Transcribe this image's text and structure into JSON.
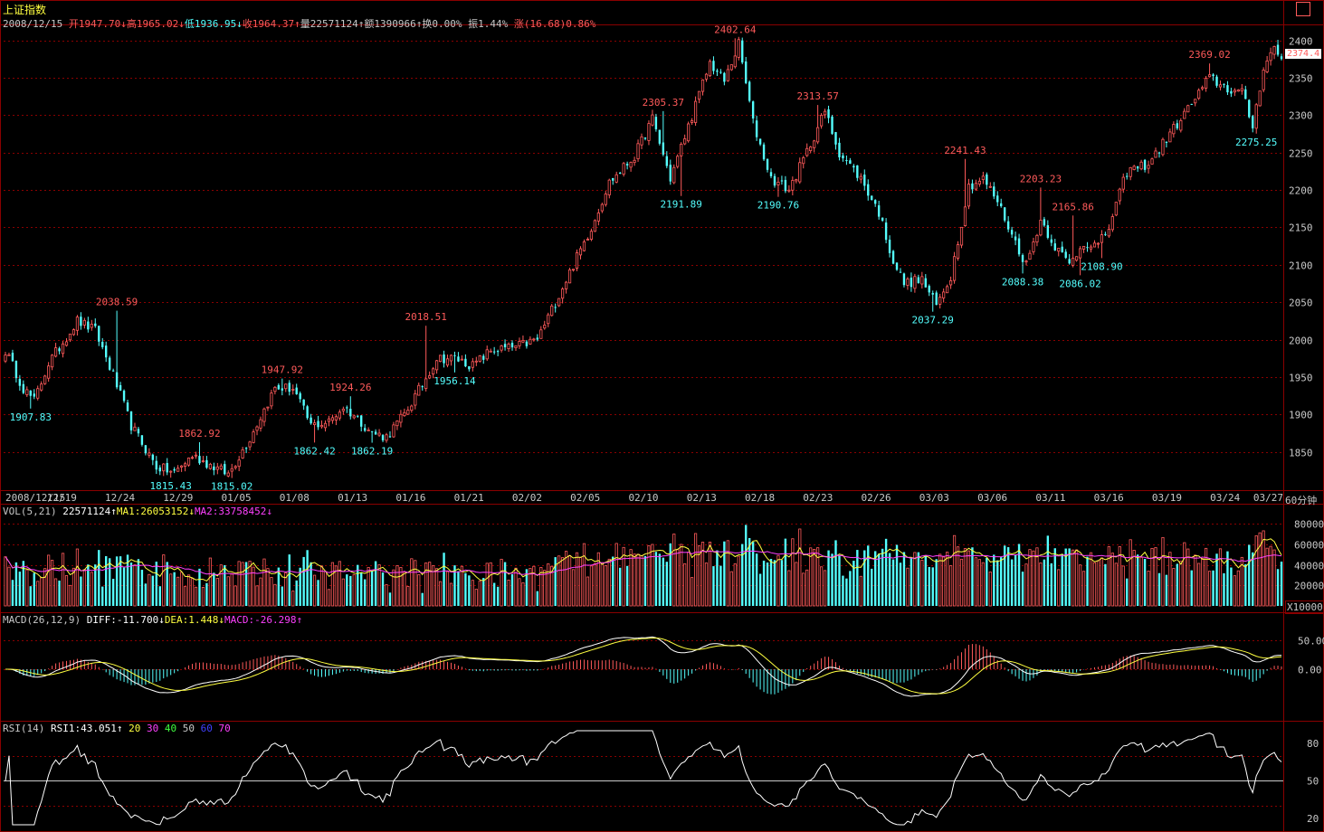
{
  "header": {
    "title": "上证指数",
    "date": "2008/12/15",
    "open_label": "开1947.70↓",
    "high_label": "高1965.02↓",
    "low_label": "低1936.95↓",
    "close_label": "收1964.37↑",
    "volume_label": "量22571124↑",
    "amount_label": "额1390966↑",
    "turnover_label": "换0.00%",
    "amplitude_label": "振1.44%",
    "change_label": "涨(16.68)0.86%"
  },
  "price_panel": {
    "current_price": "2374.4",
    "period_label": "60分钟"
  },
  "volume_panel": {
    "indicator": "VOL(5,21)",
    "value": "22571124↑",
    "ma1": "MA1:26053152↓",
    "ma2": "MA2:33758452↓",
    "unit": "X10000"
  },
  "macd_panel": {
    "indicator": "MACD(26,12,9)",
    "diff": "DIFF:-11.700↓",
    "dea": "DEA:1.448↓",
    "macd": "MACD:-26.298↑"
  },
  "rsi_panel": {
    "indicator": "RSI(14)",
    "rsi1": "RSI1:43.051↑",
    "levels": [
      "20",
      "30",
      "40",
      "50",
      "60",
      "70"
    ]
  },
  "colors": {
    "up": "#ff5a5a",
    "down": "#54ffff",
    "grid": "#8a0000",
    "axis_text": "#c8c8c8",
    "ma1": "#ffff40",
    "ma2": "#ff40ff",
    "line": "#ffffff"
  },
  "chart_data": [
    {
      "type": "candlestick",
      "ylim": [
        1800,
        2420
      ],
      "yticks": [
        1850,
        1900,
        1950,
        2000,
        2050,
        2100,
        2150,
        2200,
        2250,
        2300,
        2350,
        2400
      ],
      "x_labels": [
        "2008/12/15",
        "12/19",
        "12/24",
        "12/29",
        "01/05",
        "01/08",
        "01/13",
        "01/16",
        "01/21",
        "02/02",
        "02/05",
        "02/10",
        "02/13",
        "02/18",
        "02/23",
        "02/26",
        "03/03",
        "03/06",
        "03/11",
        "03/16",
        "03/19",
        "03/24",
        "03/27"
      ],
      "anchor_points": [
        [
          0,
          1985
        ],
        [
          5,
          1935
        ],
        [
          8,
          1918
        ],
        [
          12,
          1968
        ],
        [
          20,
          2025
        ],
        [
          25,
          2012
        ],
        [
          30,
          1952
        ],
        [
          35,
          1885
        ],
        [
          42,
          1830
        ],
        [
          47,
          1822
        ],
        [
          52,
          1845
        ],
        [
          58,
          1830
        ],
        [
          62,
          1820
        ],
        [
          68,
          1868
        ],
        [
          75,
          1935
        ],
        [
          80,
          1935
        ],
        [
          85,
          1885
        ],
        [
          90,
          1890
        ],
        [
          94,
          1910
        ],
        [
          98,
          1895
        ],
        [
          102,
          1875
        ],
        [
          106,
          1870
        ],
        [
          111,
          1900
        ],
        [
          116,
          1940
        ],
        [
          120,
          1975
        ],
        [
          125,
          1975
        ],
        [
          130,
          1965
        ],
        [
          135,
          1985
        ],
        [
          142,
          1990
        ],
        [
          148,
          2000
        ],
        [
          152,
          2040
        ],
        [
          158,
          2100
        ],
        [
          163,
          2150
        ],
        [
          168,
          2210
        ],
        [
          175,
          2245
        ],
        [
          180,
          2295
        ],
        [
          185,
          2215
        ],
        [
          190,
          2285
        ],
        [
          196,
          2370
        ],
        [
          200,
          2345
        ],
        [
          204,
          2395
        ],
        [
          208,
          2290
        ],
        [
          213,
          2215
        ],
        [
          218,
          2200
        ],
        [
          222,
          2240
        ],
        [
          228,
          2305
        ],
        [
          232,
          2250
        ],
        [
          238,
          2215
        ],
        [
          243,
          2170
        ],
        [
          247,
          2105
        ],
        [
          250,
          2075
        ],
        [
          255,
          2080
        ],
        [
          259,
          2045
        ],
        [
          263,
          2085
        ],
        [
          268,
          2205
        ],
        [
          272,
          2215
        ],
        [
          276,
          2185
        ],
        [
          280,
          2140
        ],
        [
          284,
          2100
        ],
        [
          288,
          2160
        ],
        [
          292,
          2125
        ],
        [
          296,
          2100
        ],
        [
          300,
          2130
        ],
        [
          304,
          2125
        ],
        [
          307,
          2150
        ],
        [
          312,
          2225
        ],
        [
          318,
          2235
        ],
        [
          324,
          2275
        ],
        [
          330,
          2315
        ],
        [
          335,
          2350
        ],
        [
          340,
          2335
        ],
        [
          344,
          2330
        ],
        [
          347,
          2285
        ],
        [
          350,
          2365
        ],
        [
          353,
          2390
        ],
        [
          355,
          2375
        ]
      ],
      "labels": [
        {
          "i": 7,
          "text": "1907.83",
          "pos": "below",
          "value": 1907.83
        },
        {
          "i": 31,
          "text": "2038.59",
          "pos": "above",
          "value": 2038.59
        },
        {
          "i": 46,
          "text": "1815.43",
          "pos": "below",
          "value": 1815.43
        },
        {
          "i": 54,
          "text": "1862.92",
          "pos": "above",
          "value": 1862.92
        },
        {
          "i": 63,
          "text": "1815.02",
          "pos": "below",
          "value": 1815.02
        },
        {
          "i": 77,
          "text": "1947.92",
          "pos": "above",
          "value": 1947.92
        },
        {
          "i": 86,
          "text": "1862.42",
          "pos": "below",
          "value": 1862.42
        },
        {
          "i": 96,
          "text": "1924.26",
          "pos": "above",
          "value": 1924.26
        },
        {
          "i": 102,
          "text": "1862.19",
          "pos": "below",
          "value": 1862.19
        },
        {
          "i": 117,
          "text": "2018.51",
          "pos": "above",
          "value": 2018.51
        },
        {
          "i": 125,
          "text": "1956.14",
          "pos": "below",
          "value": 1956.14
        },
        {
          "i": 183,
          "text": "2305.37",
          "pos": "above",
          "value": 2305.37
        },
        {
          "i": 188,
          "text": "2191.89",
          "pos": "below",
          "value": 2191.89
        },
        {
          "i": 203,
          "text": "2402.64",
          "pos": "above",
          "value": 2402.64
        },
        {
          "i": 215,
          "text": "2190.76",
          "pos": "below",
          "value": 2190.76
        },
        {
          "i": 226,
          "text": "2313.57",
          "pos": "above",
          "value": 2313.57
        },
        {
          "i": 258,
          "text": "2037.29",
          "pos": "below",
          "value": 2037.29
        },
        {
          "i": 267,
          "text": "2241.43",
          "pos": "above",
          "value": 2241.43
        },
        {
          "i": 283,
          "text": "2088.38",
          "pos": "below",
          "value": 2088.38
        },
        {
          "i": 288,
          "text": "2203.23",
          "pos": "above",
          "value": 2203.23
        },
        {
          "i": 297,
          "text": "2165.86",
          "pos": "above",
          "value": 2165.86
        },
        {
          "i": 299,
          "text": "2086.02",
          "pos": "below",
          "value": 2086.02
        },
        {
          "i": 305,
          "text": "2108.90",
          "pos": "below",
          "value": 2108.9
        },
        {
          "i": 335,
          "text": "2369.02",
          "pos": "above",
          "value": 2369.02
        },
        {
          "i": 348,
          "text": "2275.25",
          "pos": "below",
          "value": 2275.25
        }
      ]
    },
    {
      "type": "bar",
      "name": "VOL",
      "ylim": [
        0,
        90000
      ],
      "yticks": [
        20000,
        40000,
        60000,
        80000
      ],
      "unit": "X10000"
    },
    {
      "type": "bar",
      "name": "MACD",
      "ylim": [
        -80,
        80
      ],
      "yticks": [
        0,
        50
      ]
    },
    {
      "type": "line",
      "name": "RSI",
      "ylim": [
        15,
        90
      ],
      "yticks": [
        20,
        50,
        80
      ],
      "reference_lines": [
        30,
        50,
        70
      ]
    }
  ]
}
